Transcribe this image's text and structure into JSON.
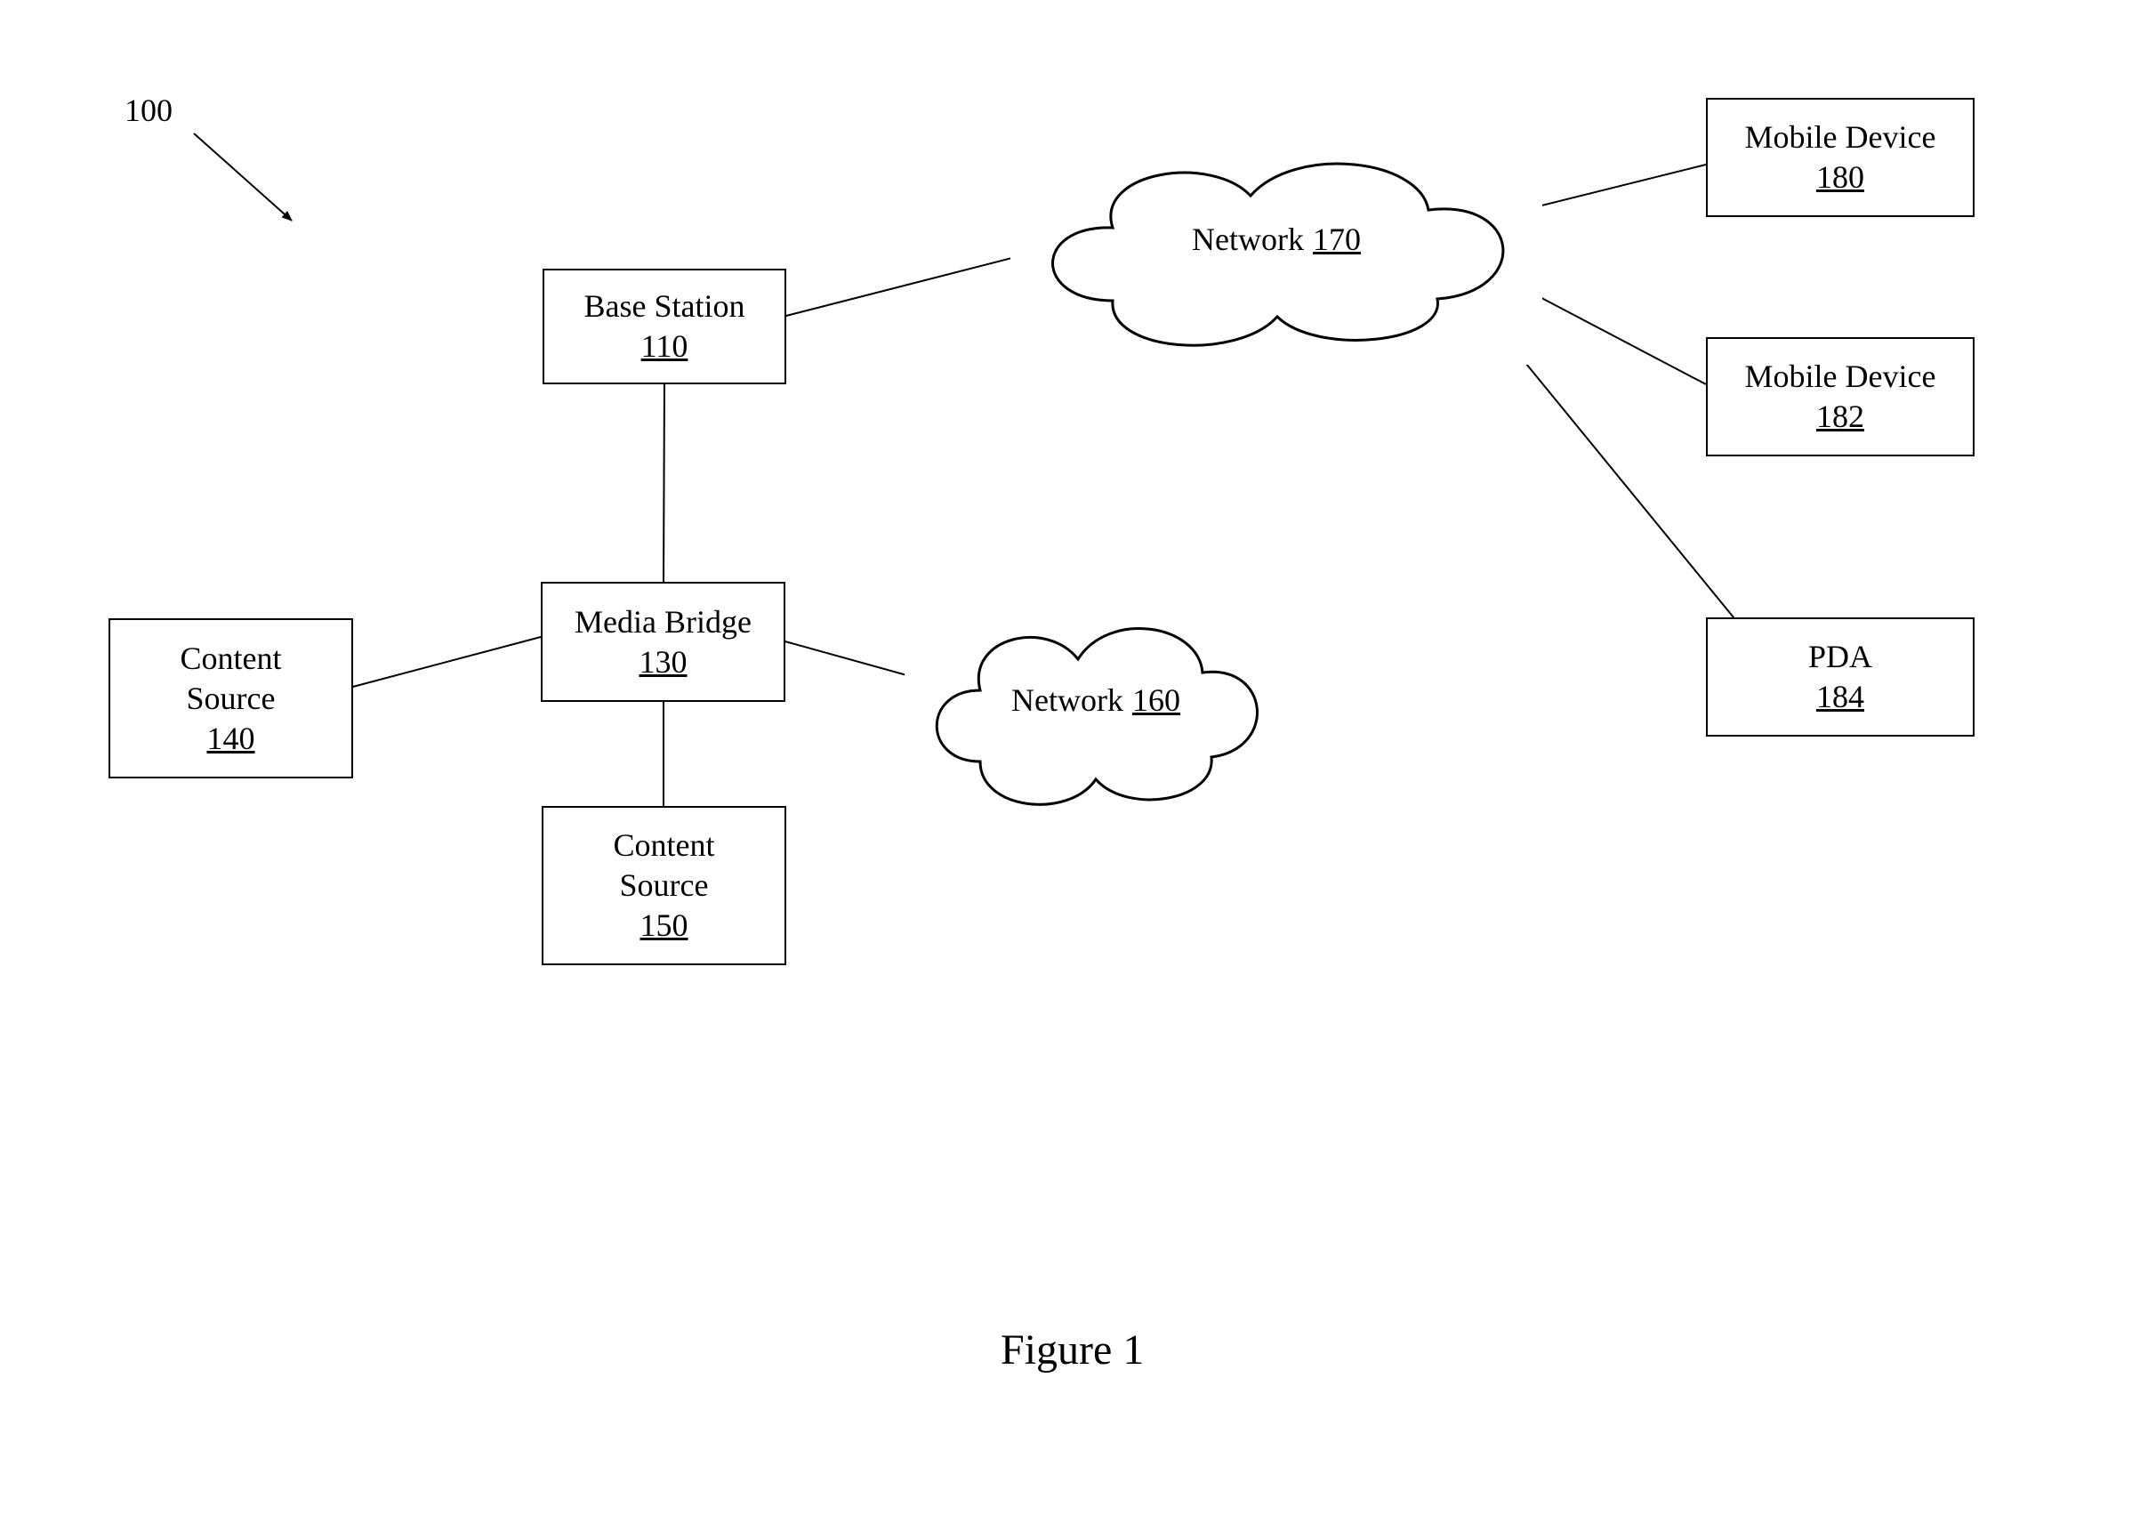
{
  "diagram": {
    "ref_label": "100",
    "figure_caption": "Figure 1",
    "base_station": {
      "label": "Base Station",
      "ref": "110"
    },
    "media_bridge": {
      "label": "Media Bridge",
      "ref": "130"
    },
    "content_source_140": {
      "label_line1": "Content",
      "label_line2": "Source",
      "ref": "140"
    },
    "content_source_150": {
      "label_line1": "Content",
      "label_line2": "Source",
      "ref": "150"
    },
    "network_160": {
      "label": "Network",
      "ref": "160"
    },
    "network_170": {
      "label": "Network",
      "ref": "170"
    },
    "mobile_device_180": {
      "label": "Mobile Device",
      "ref": "180"
    },
    "mobile_device_182": {
      "label": "Mobile Device",
      "ref": "182"
    },
    "pda_184": {
      "label": "PDA",
      "ref": "184"
    }
  }
}
